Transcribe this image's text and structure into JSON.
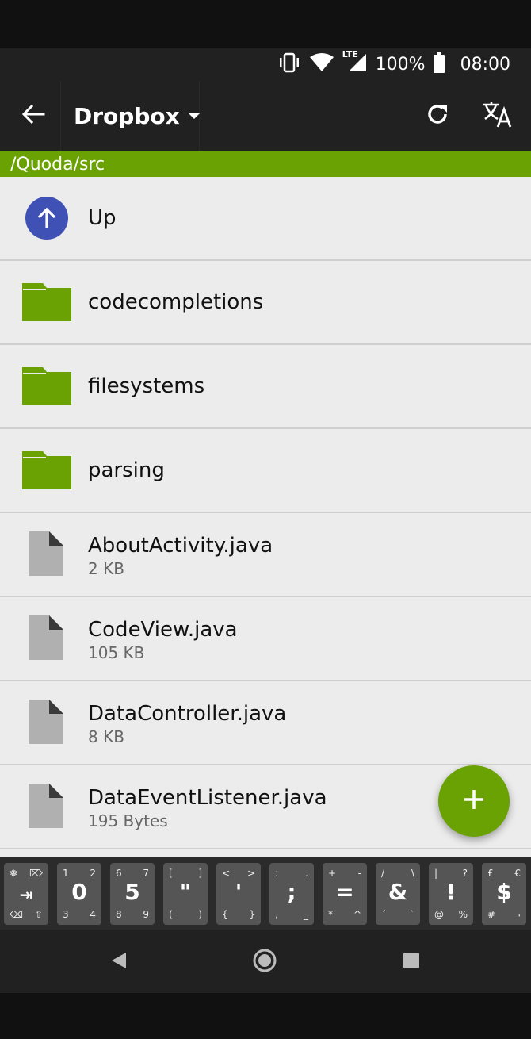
{
  "status_bar": {
    "battery": "100%",
    "time": "08:00",
    "network": "LTE"
  },
  "app_bar": {
    "title": "Dropbox"
  },
  "path": "/Quoda/src",
  "list": {
    "up_label": "Up",
    "folders": [
      {
        "name": "codecompletions"
      },
      {
        "name": "filesystems"
      },
      {
        "name": "parsing"
      }
    ],
    "files": [
      {
        "name": "AboutActivity.java",
        "size": "2 KB"
      },
      {
        "name": "CodeView.java",
        "size": "105 KB"
      },
      {
        "name": "DataController.java",
        "size": "8 KB"
      },
      {
        "name": "DataEventListener.java",
        "size": "195 Bytes"
      }
    ]
  },
  "fab": {
    "icon": "plus-icon"
  },
  "keyboard_bar": {
    "keys": [
      {
        "center": "",
        "tl": "❅",
        "tr": "⌦",
        "bl": "⌫",
        "br": "⇧"
      },
      {
        "center": "0",
        "tl": "1",
        "tr": "2",
        "bl": "3",
        "br": "4"
      },
      {
        "center": "5",
        "tl": "6",
        "tr": "7",
        "bl": "8",
        "br": "9"
      },
      {
        "center": "\"",
        "tl": "[",
        "tr": "]",
        "bl": "(",
        "br": ")"
      },
      {
        "center": "'",
        "tl": "<",
        "tr": ">",
        "bl": "{",
        "br": "}"
      },
      {
        "center": ";",
        "tl": ":",
        "tr": ".",
        "bl": ",",
        "br": "_"
      },
      {
        "center": "=",
        "tl": "+",
        "tr": "-",
        "bl": "*",
        "br": "^"
      },
      {
        "center": "&",
        "tl": "/",
        "tr": "\\",
        "bl": "´",
        "br": "`"
      },
      {
        "center": "!",
        "tl": "|",
        "tr": "?",
        "bl": "@",
        "br": "%"
      },
      {
        "center": "$",
        "tl": "£",
        "tr": "€",
        "bl": "#",
        "br": "¬"
      }
    ]
  },
  "colors": {
    "accent": "#6aa203",
    "up_icon": "#3f51b5",
    "app_bar": "#212121",
    "list_bg": "#ececec"
  }
}
